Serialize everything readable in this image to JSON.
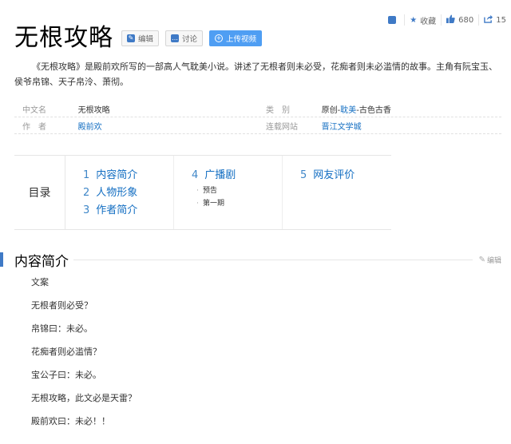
{
  "toolbar": {
    "add_icon_char": "+",
    "collect_label": "收藏",
    "like_count": "680",
    "share_count": "15"
  },
  "title": "无根攻略",
  "buttons": {
    "edit": "编辑",
    "discuss": "讨论",
    "upload_video": "上传视频"
  },
  "summary": "《无根攻略》是殿前欢所写的一部高人气耽美小说。讲述了无根者则未必受，花痴者则未必滥情的故事。主角有阮宝玉、侯爷帛锦、天子帛泠、萧彻。",
  "basic_info": {
    "rows": [
      {
        "left_name": "中文名",
        "left_value": "无根攻略",
        "right_name": "类　别",
        "right_value_pre": "原创-",
        "right_value_link": "耽美",
        "right_value_post": "-古色古香"
      },
      {
        "left_name": "作　者",
        "left_value": "殿前欢",
        "right_name": "连载网站",
        "right_value_link": "晋江文学城"
      }
    ]
  },
  "catalog": {
    "label": "目录",
    "col1": [
      {
        "num": "1",
        "label": "内容简介"
      },
      {
        "num": "2",
        "label": "人物形象"
      },
      {
        "num": "3",
        "label": "作者简介"
      }
    ],
    "col2": {
      "num": "4",
      "label": "广播剧",
      "subs": [
        "预告",
        "第一期"
      ]
    },
    "col3": {
      "num": "5",
      "label": "网友评价"
    }
  },
  "section": {
    "title": "内容简介",
    "edit_label": "编辑",
    "paragraphs": [
      "文案",
      "无根者则必受？",
      "帛锦曰：未必。",
      "花痴者则必滥情？",
      "宝公子曰：未必。",
      "无根攻略，此文必是天雷？",
      "殿前欢曰：未必！！"
    ]
  },
  "colors": {
    "accent": "#3f7ac6",
    "link": "#136ec2",
    "upload_button": "#4f9ef3"
  }
}
